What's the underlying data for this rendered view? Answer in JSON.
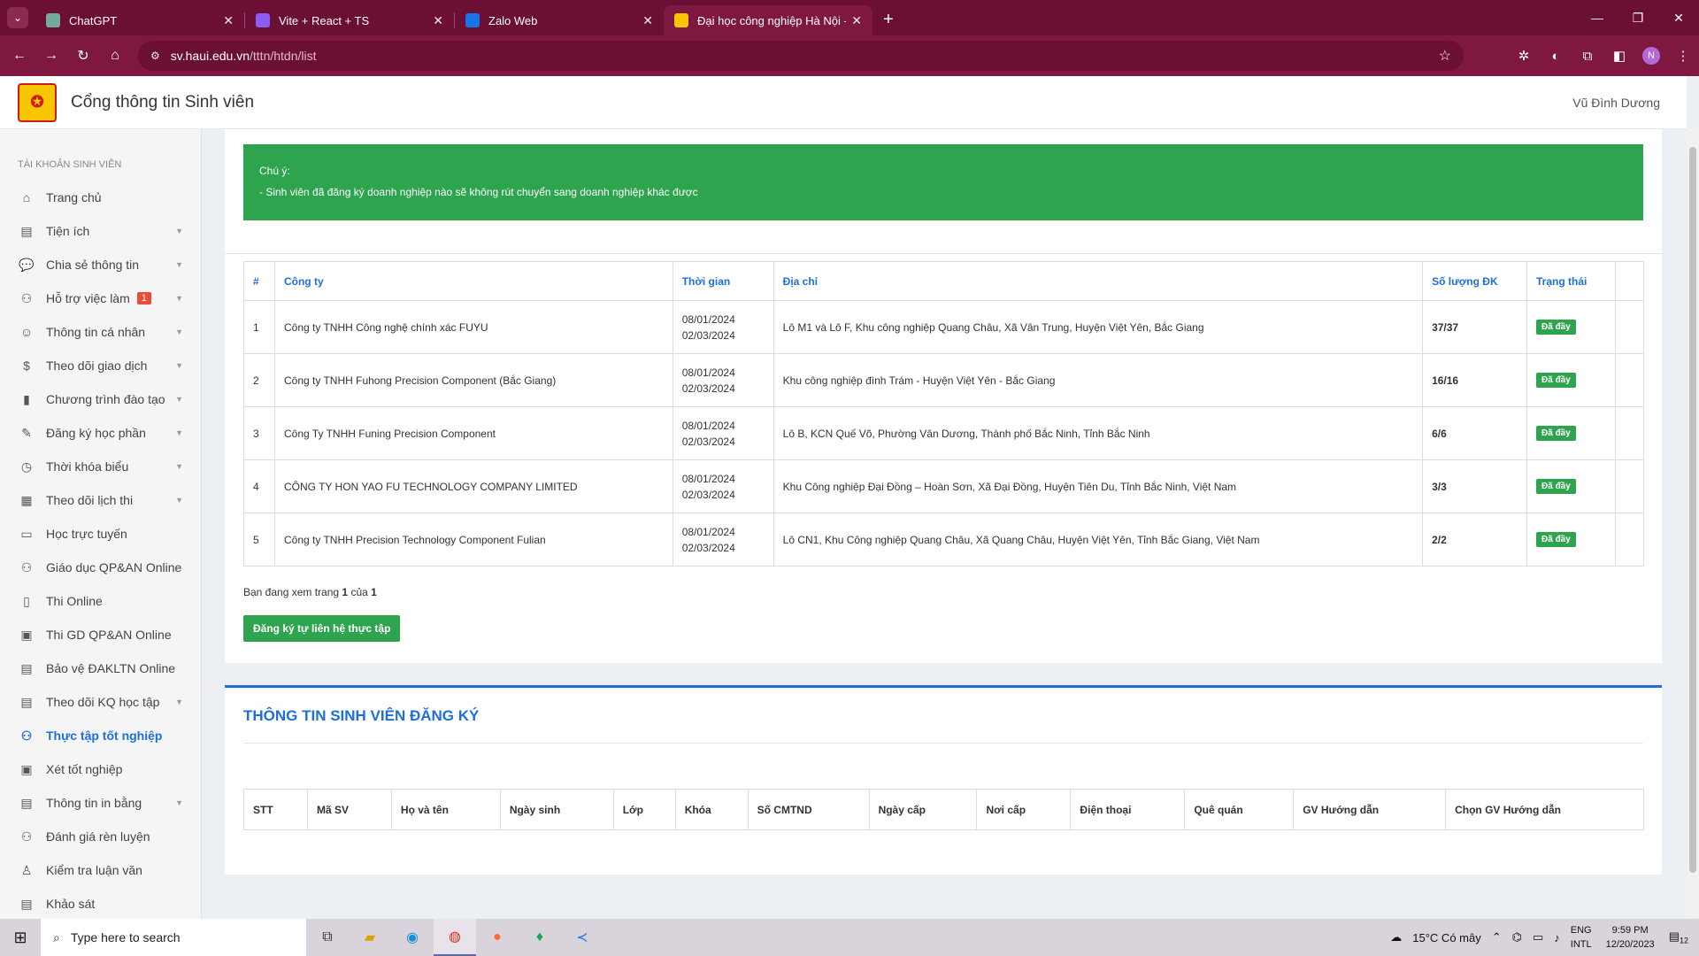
{
  "browser": {
    "tabs": [
      {
        "title": "ChatGPT",
        "fav_color": "#74aa9c",
        "active": false
      },
      {
        "title": "Vite + React + TS",
        "fav_color": "#8b5cf6",
        "active": false
      },
      {
        "title": "Zalo Web",
        "fav_color": "#1a73e8",
        "active": false
      },
      {
        "title": "Đại học công nghiệp Hà Nội - C",
        "fav_color": "#f7c600",
        "active": true
      }
    ],
    "url_host": "sv.haui.edu.vn",
    "url_path": "/tttn/htdn/list",
    "profile_initial": "N"
  },
  "header": {
    "title": "Cổng thông tin Sinh viên",
    "user": "Vũ Đình Dương"
  },
  "sidebar": {
    "heading": "TÀI KHOẢN SINH VIÊN",
    "items": [
      {
        "label": "Trang chủ",
        "icon": "home-icon",
        "glyph": "⌂",
        "caret": false
      },
      {
        "label": "Tiện ích",
        "icon": "book-icon",
        "glyph": "▤",
        "caret": true
      },
      {
        "label": "Chia sẻ thông tin",
        "icon": "chat-icon",
        "glyph": "💬",
        "caret": true
      },
      {
        "label": "Hỗ trợ việc làm",
        "icon": "network-icon",
        "glyph": "⚇",
        "caret": true,
        "badge": "1"
      },
      {
        "label": "Thông tin cá nhân",
        "icon": "user-icon",
        "glyph": "☺",
        "caret": true
      },
      {
        "label": "Theo dõi giao dịch",
        "icon": "transaction-icon",
        "glyph": "$",
        "caret": true
      },
      {
        "label": "Chương trình đào tạo",
        "icon": "book-icon",
        "glyph": "▮",
        "caret": true
      },
      {
        "label": "Đăng ký học phần",
        "icon": "register-icon",
        "glyph": "✎",
        "caret": true
      },
      {
        "label": "Thời khóa biểu",
        "icon": "clock-icon",
        "glyph": "◷",
        "caret": true
      },
      {
        "label": "Theo dõi lịch thi",
        "icon": "calendar-icon",
        "glyph": "▦",
        "caret": true
      },
      {
        "label": "Học trực tuyến",
        "icon": "monitor-icon",
        "glyph": "▭",
        "caret": false
      },
      {
        "label": "Giáo dục QP&AN Online",
        "icon": "network-icon",
        "glyph": "⚇",
        "caret": false
      },
      {
        "label": "Thi Online",
        "icon": "exam-icon",
        "glyph": "▯",
        "caret": false
      },
      {
        "label": "Thi GD QP&AN Online",
        "icon": "exam-icon",
        "glyph": "▣",
        "caret": false
      },
      {
        "label": "Bảo vệ ĐAKLTN Online",
        "icon": "defense-icon",
        "glyph": "▤",
        "caret": false
      },
      {
        "label": "Theo dõi KQ học tập",
        "icon": "result-icon",
        "glyph": "▤",
        "caret": true
      },
      {
        "label": "Thực tập tốt nghiệp",
        "icon": "internship-icon",
        "glyph": "⚇",
        "caret": false,
        "active": true
      },
      {
        "label": "Xét tốt nghiệp",
        "icon": "graduation-icon",
        "glyph": "▣",
        "caret": false
      },
      {
        "label": "Thông tin in bằng",
        "icon": "certificate-icon",
        "glyph": "▤",
        "caret": true
      },
      {
        "label": "Đánh giá rèn luyện",
        "icon": "evaluation-icon",
        "glyph": "⚇",
        "caret": false
      },
      {
        "label": "Kiểm tra luận văn",
        "icon": "thesis-icon",
        "glyph": "♙",
        "caret": false
      },
      {
        "label": "Khảo sát",
        "icon": "survey-icon",
        "glyph": "▤",
        "caret": false
      }
    ]
  },
  "notice": {
    "title": "Chú ý:",
    "text": "- Sinh viên đã đăng ký doanh nghiệp nào sẽ không rút chuyển sang doanh nghiệp khác được"
  },
  "companies": {
    "headers": [
      "#",
      "Công ty",
      "Thời gian",
      "Địa chỉ",
      "Số lượng ĐK",
      "Trạng thái",
      ""
    ],
    "rows": [
      {
        "no": "1",
        "company": "Công ty TNHH Công nghệ chính xác FUYU",
        "start": "08/01/2024",
        "end": "02/03/2024",
        "address": "Lô M1 và Lô F, Khu công nghiệp Quang Châu, Xã Vân Trung, Huyện Việt Yên, Bắc Giang",
        "count": "37/37",
        "status": "Đã đầy"
      },
      {
        "no": "2",
        "company": "Công ty TNHH Fuhong Precision Component (Bắc Giang)",
        "start": "08/01/2024",
        "end": "02/03/2024",
        "address": "Khu công nghiệp đình Trám - Huyện Việt Yên - Bắc Giang",
        "count": "16/16",
        "status": "Đã đầy"
      },
      {
        "no": "3",
        "company": "Công Ty TNHH Funing Precision Component",
        "start": "08/01/2024",
        "end": "02/03/2024",
        "address": "Lô B, KCN Quế Võ, Phường Vân Dương, Thành phố Bắc Ninh, Tỉnh Bắc Ninh",
        "count": "6/6",
        "status": "Đã đầy"
      },
      {
        "no": "4",
        "company": "CÔNG TY HON YAO FU TECHNOLOGY COMPANY LIMITED",
        "start": "08/01/2024",
        "end": "02/03/2024",
        "address": "Khu Công nghiệp Đại Đồng – Hoàn Sơn, Xã Đại Đồng, Huyện Tiên Du, Tỉnh Bắc Ninh, Việt Nam",
        "count": "3/3",
        "status": "Đã đầy"
      },
      {
        "no": "5",
        "company": "Công ty TNHH Precision Technology Component Fulian",
        "start": "08/01/2024",
        "end": "02/03/2024",
        "address": "Lô CN1, Khu Công nghiệp Quang Châu, Xã Quang Châu, Huyện Việt Yên, Tỉnh Bắc Giang, Việt Nam",
        "count": "2/2",
        "status": "Đã đầy"
      }
    ],
    "page_prefix": "Bạn đang xem trang",
    "page_current": "1",
    "page_of": "của",
    "page_total": "1",
    "register_button": "Đăng ký tự liên hệ thực tập"
  },
  "registration": {
    "title": "THÔNG TIN SINH VIÊN ĐĂNG KÝ",
    "headers": [
      "STT",
      "Mã SV",
      "Họ và tên",
      "Ngày sinh",
      "Lớp",
      "Khóa",
      "Số CMTND",
      "Ngày cấp",
      "Nơi cấp",
      "Điện thoại",
      "Quê quán",
      "GV Hướng dẫn",
      "Chọn GV Hướng dẫn"
    ]
  },
  "taskbar": {
    "search_placeholder": "Type here to search",
    "weather": "15°C  Có mây",
    "lang_top": "ENG",
    "lang_bottom": "INTL",
    "time": "9:59 PM",
    "date": "12/20/2023",
    "notif_count": "12"
  }
}
